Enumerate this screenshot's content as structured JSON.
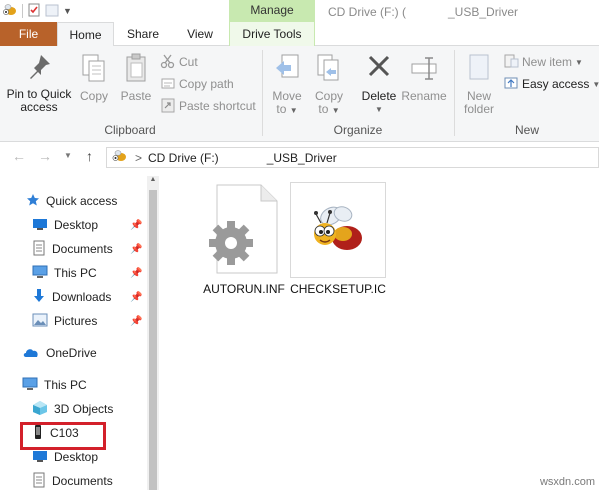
{
  "titlebar": {
    "manage": "Manage",
    "title_drive": "CD Drive (F:) (",
    "title_folder": "_USB_Driver"
  },
  "tabs": {
    "file": "File",
    "home": "Home",
    "share": "Share",
    "view": "View",
    "drive_tools": "Drive Tools"
  },
  "ribbon": {
    "clipboard": {
      "label": "Clipboard",
      "pin_quick_access": [
        "Pin to Quick",
        "access"
      ],
      "copy": "Copy",
      "paste": "Paste",
      "cut": "Cut",
      "copy_path": "Copy path",
      "paste_shortcut": "Paste shortcut"
    },
    "organize": {
      "label": "Organize",
      "move_to": [
        "Move",
        "to"
      ],
      "copy_to": [
        "Copy",
        "to"
      ],
      "delete": "Delete",
      "rename": "Rename"
    },
    "new": {
      "label": "New",
      "new_folder": [
        "New",
        "folder"
      ],
      "new_item": "New item",
      "easy_access": "Easy access"
    }
  },
  "address": {
    "drive": "CD Drive (F:)",
    "folder": "_USB_Driver"
  },
  "nav": {
    "quick_access": "Quick access",
    "items": [
      {
        "label": "Desktop",
        "icon": "desktop-icon"
      },
      {
        "label": "Documents",
        "icon": "documents-icon"
      },
      {
        "label": "This PC",
        "icon": "this-pc-icon"
      },
      {
        "label": "Downloads",
        "icon": "downloads-icon"
      },
      {
        "label": "Pictures",
        "icon": "pictures-icon"
      }
    ],
    "onedrive": "OneDrive",
    "this_pc": "This PC",
    "sub_items": [
      {
        "label": "3D Objects"
      },
      {
        "label": "C103"
      },
      {
        "label": "Desktop"
      },
      {
        "label": "Documents"
      }
    ]
  },
  "files": [
    {
      "name": "AUTORUN.INF",
      "icon": "settings-file-icon"
    },
    {
      "name": "CHECKSETUP.IC",
      "icon": "bee-icon"
    }
  ],
  "watermark": "wsxdn.com",
  "colors": {
    "file_tab": "#b8622a",
    "manage_tab": "#c8e9b0",
    "highlight": "#d3202a",
    "folder_blue": "#1e78d7"
  }
}
